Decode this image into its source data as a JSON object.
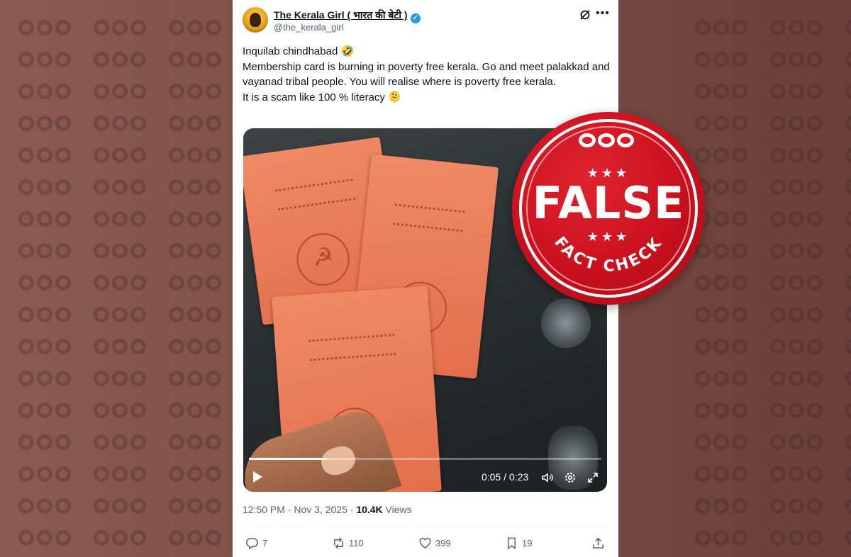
{
  "post": {
    "author_name": "The Kerala Girl ( भारत की बेटी )",
    "author_handle": "@the_kerala_girl",
    "text_lines": [
      "Inquilab chindhabad 🤣",
      "Membership card is burning in poverty free kerala. Go and meet palakkad and vayanad tribal people. You will realise where is poverty free kerala.",
      "It is a scam like 100 % literacy 🫠"
    ],
    "timestamp": "12:50 PM · Nov 3, 2025 · ",
    "views_count": "10.4K",
    "views_label": " Views"
  },
  "video": {
    "time": "0:05 / 0:23",
    "progress_fraction": 0.22
  },
  "actions": {
    "replies": "7",
    "reposts": "110",
    "likes": "399",
    "bookmarks": "19"
  },
  "stamp": {
    "verdict": "FALSE",
    "label": "FACT CHECK",
    "stars_top": "★★★",
    "stars_bottom": "★★★"
  },
  "colors": {
    "stamp_red": "#c8111d",
    "verified_blue": "#1d9bf0",
    "background": "#7a4c44"
  },
  "icons": [
    "verified-badge-icon",
    "grok-icon",
    "more-icon",
    "play-icon",
    "volume-icon",
    "settings-gear-icon",
    "fullscreen-icon",
    "reply-icon",
    "repost-icon",
    "like-icon",
    "bookmark-icon",
    "share-icon"
  ]
}
